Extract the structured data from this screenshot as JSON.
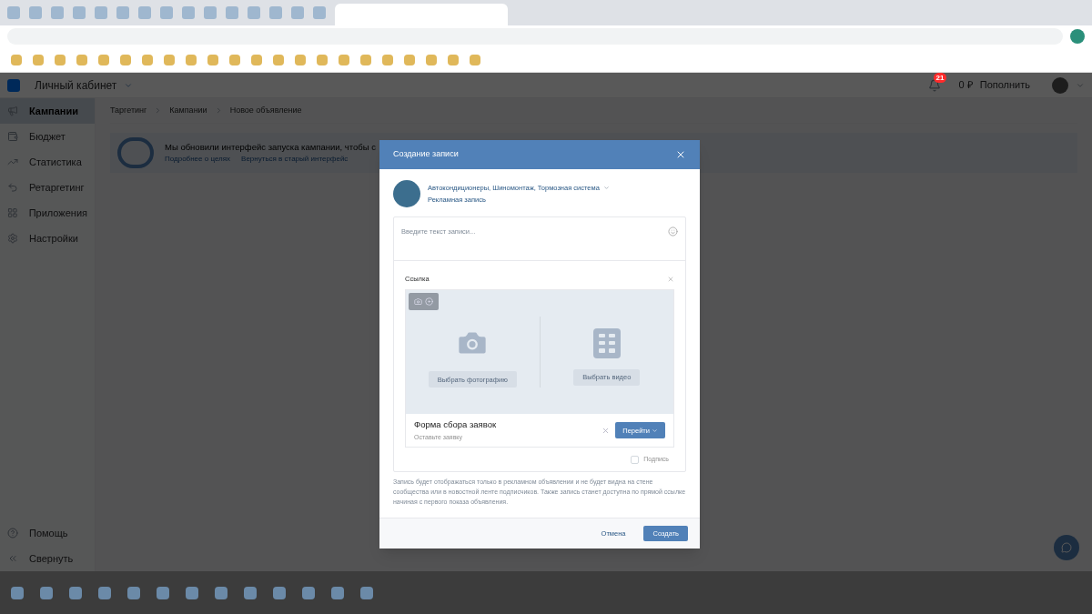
{
  "header": {
    "title": "Личный кабинет",
    "notifications": "21",
    "balance": "0 ₽",
    "top_up": "Пополнить"
  },
  "sidebar": {
    "items": [
      {
        "label": "Кампании",
        "selected": true
      },
      {
        "label": "Бюджет",
        "selected": false
      },
      {
        "label": "Статистика",
        "selected": false
      },
      {
        "label": "Ретаргетинг",
        "selected": false
      },
      {
        "label": "Приложения",
        "selected": false
      },
      {
        "label": "Настройки",
        "selected": false
      }
    ],
    "bottom": [
      {
        "label": "Помощь"
      },
      {
        "label": "Свернуть"
      }
    ]
  },
  "breadcrumbs": [
    "Таргетинг",
    "Кампании",
    "Новое объявление"
  ],
  "banner": {
    "title": "Мы обновили интерфейс запуска кампании, чтобы с",
    "links": [
      "Подробнее о целях",
      "Вернуться в старый интерфейс"
    ]
  },
  "modal": {
    "title": "Создание записи",
    "author": "Автокондиционеры, Шиномонтаж, Тормозная система",
    "subtitle": "Рекламная запись",
    "placeholder": "Введите текст записи...",
    "attachment_label": "Ссылка",
    "media_buttons": [
      "Выбрать фотографию",
      "Выбрать видео"
    ],
    "form_title": "Форма сбора заявок",
    "form_subtitle": "Оставьте заявку",
    "go_button": "Перейти",
    "signature": {
      "label": "Подпись",
      "checked": false
    },
    "note": "Запись будет отображаться только в рекламном объявлении и не будет видна на стене сообщества или в новостной ленте подписчиков. Также запись станет доступна по прямой ссылке начиная с первого показа объявления.",
    "cancel": "Отмена",
    "create": "Создать"
  }
}
